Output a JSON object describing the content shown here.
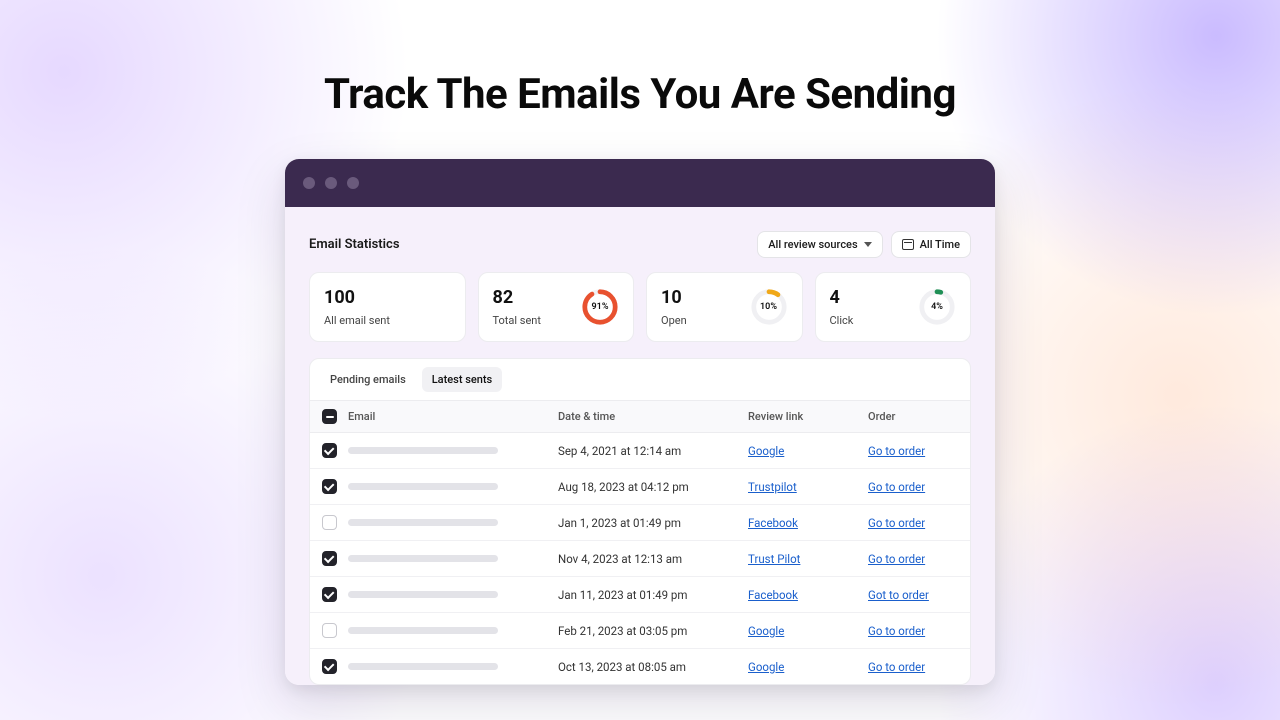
{
  "headline": "Track The Emails You Are Sending",
  "section_title": "Email Statistics",
  "filters": {
    "sources_label": "All review sources",
    "time_label": "All Time"
  },
  "stats": [
    {
      "value": "100",
      "label": "All email sent"
    },
    {
      "value": "82",
      "label": "Total sent",
      "pct": 91,
      "pct_text": "91%",
      "color": "#e8512f"
    },
    {
      "value": "10",
      "label": "Open",
      "pct": 10,
      "pct_text": "10%",
      "color": "#f0a818"
    },
    {
      "value": "4",
      "label": "Click",
      "pct": 4,
      "pct_text": "4%",
      "color": "#1f8f55"
    }
  ],
  "tabs": {
    "pending": "Pending emails",
    "latest": "Latest sents"
  },
  "columns": {
    "email": "Email",
    "date": "Date & time",
    "review": "Review link",
    "order": "Order"
  },
  "rows": [
    {
      "checked": true,
      "date": "Sep 4, 2021 at 12:14 am",
      "review": "Google",
      "order": "Go to order"
    },
    {
      "checked": true,
      "date": "Aug 18, 2023 at 04:12 pm",
      "review": "Trustpilot",
      "order": "Go to order"
    },
    {
      "checked": false,
      "date": "Jan 1, 2023 at 01:49 pm",
      "review": "Facebook",
      "order": "Go to order"
    },
    {
      "checked": true,
      "date": "Nov 4, 2023 at 12:13 am",
      "review": "Trust Pilot",
      "order": "Go to order"
    },
    {
      "checked": true,
      "date": "Jan 11, 2023 at 01:49 pm",
      "review": "Facebook",
      "order": "Got to order"
    },
    {
      "checked": false,
      "date": "Feb 21, 2023 at 03:05 pm",
      "review": "Google",
      "order": "Go to order"
    },
    {
      "checked": true,
      "date": "Oct 13, 2023 at 08:05 am",
      "review": "Google",
      "order": "Go to order"
    }
  ],
  "chart_data": [
    {
      "type": "pie",
      "title": "Total sent",
      "values": [
        91,
        9
      ],
      "categories": [
        "sent",
        "remaining"
      ]
    },
    {
      "type": "pie",
      "title": "Open",
      "values": [
        10,
        90
      ],
      "categories": [
        "open",
        "remaining"
      ]
    },
    {
      "type": "pie",
      "title": "Click",
      "values": [
        4,
        96
      ],
      "categories": [
        "click",
        "remaining"
      ]
    }
  ]
}
